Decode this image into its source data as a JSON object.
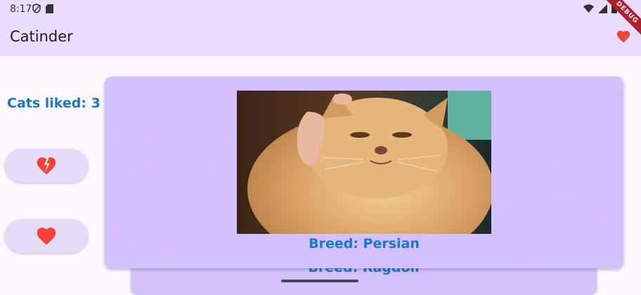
{
  "status_bar": {
    "time": "8:17"
  },
  "app_bar": {
    "title": "Catinder",
    "debug_banner": "DEBUG"
  },
  "sidebar": {
    "liked_label": "Cats liked: 3"
  },
  "cards": {
    "front": {
      "breed": "Breed: Persian",
      "photo_subject": "Persian cat"
    },
    "back": {
      "breed": "Breed: Ragdoll"
    }
  },
  "icons": {
    "status_left": [
      "shield-icon",
      "sd-card-icon"
    ],
    "status_right": [
      "wifi-icon",
      "signal-icon",
      "battery-icon"
    ],
    "app_bar_right": "heart-icon",
    "dislike_button": "broken-heart-icon",
    "like_button": "heart-icon"
  },
  "colors": {
    "app_bar": "#eaddff",
    "background": "#fdf7ff",
    "card": "#d3c1ff",
    "accent_text": "#1976d2",
    "heart": "#f44336"
  }
}
